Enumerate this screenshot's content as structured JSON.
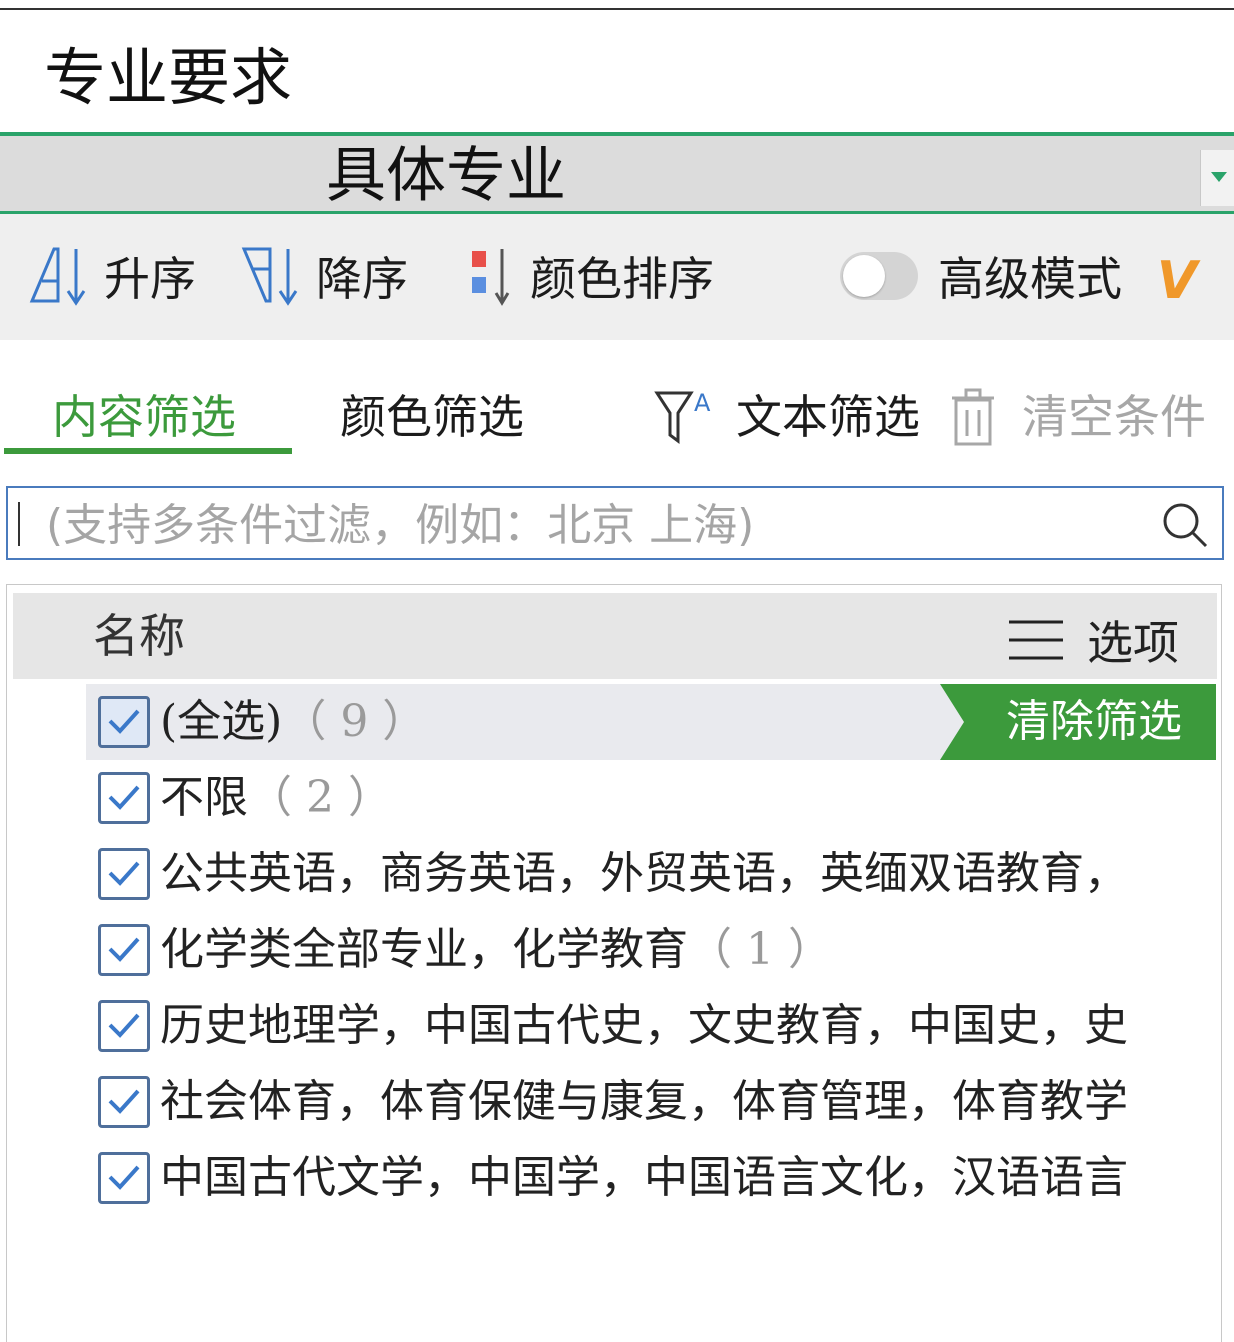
{
  "page": {
    "title": "专业要求"
  },
  "column_header": {
    "label": "具体专业"
  },
  "sort_bar": {
    "ascending": "升序",
    "descending": "降序",
    "color_sort": "颜色排序",
    "advanced_mode": "高级模式",
    "advanced_mode_on": false,
    "vip_badge": "V"
  },
  "filter_tabs": {
    "content_filter": "内容筛选",
    "color_filter": "颜色筛选",
    "text_filter": "文本筛选",
    "clear_conditions": "清空条件"
  },
  "search": {
    "placeholder": "(支持多条件过滤，例如：北京  上海)"
  },
  "list": {
    "name_header": "名称",
    "options_label": "选项",
    "clear_filter_label": "清除筛选",
    "items": [
      {
        "label": "(全选)",
        "count": "（ 9 ）",
        "checked": true
      },
      {
        "label": "不限",
        "count": "（ 2 ）",
        "checked": true
      },
      {
        "label": "公共英语，商务英语，外贸英语，英缅双语教育，",
        "count": "",
        "checked": true
      },
      {
        "label": "化学类全部专业，化学教育",
        "count": "（ 1 ）",
        "checked": true
      },
      {
        "label": "历史地理学，中国古代史，文史教育，中国史，史",
        "count": "",
        "checked": true
      },
      {
        "label": "社会体育，体育保健与康复，体育管理，体育教学",
        "count": "",
        "checked": true
      },
      {
        "label": "中国古代文学，中国学，中国语言文化，汉语语言",
        "count": "",
        "checked": true
      }
    ]
  },
  "colors": {
    "accent_green": "#3c9a3c",
    "header_rule_green": "#2aa36a",
    "checkbox_border": "#4f6f9b",
    "checkmark_blue": "#3a78c9",
    "search_border": "#4a7bbd",
    "vip_orange": "#f0982a"
  }
}
